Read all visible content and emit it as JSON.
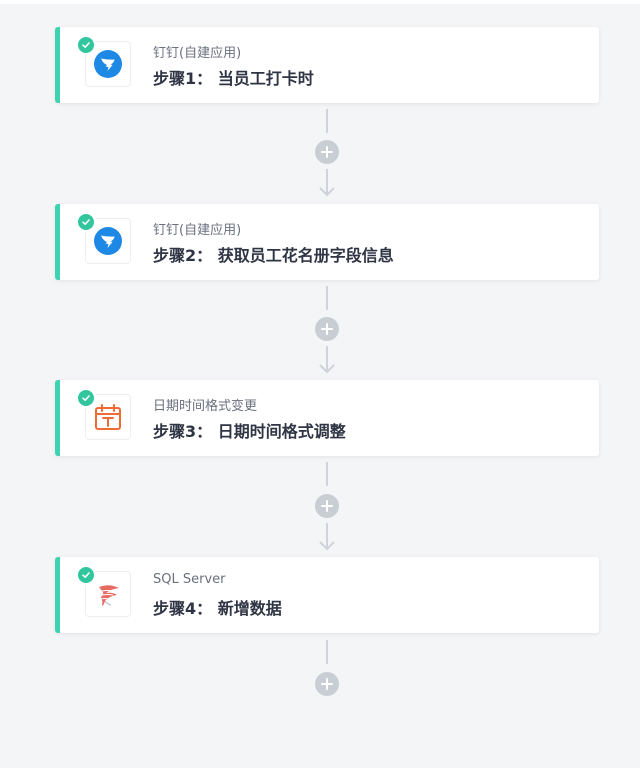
{
  "workflow": {
    "steps": [
      {
        "app_name": "钉钉(自建应用)",
        "title": "步骤1： 当员工打卡时",
        "icon": "dingtalk-icon",
        "status": "success"
      },
      {
        "app_name": "钉钉(自建应用)",
        "title": "步骤2： 获取员工花名册字段信息",
        "icon": "dingtalk-icon",
        "status": "success"
      },
      {
        "app_name": "日期时间格式变更",
        "title": "步骤3： 日期时间格式调整",
        "icon": "calendar-icon",
        "status": "success"
      },
      {
        "app_name": "SQL Server",
        "title": "步骤4： 新增数据",
        "icon": "sql-server-icon",
        "status": "success"
      }
    ]
  },
  "colors": {
    "accent": "#3ed3b0",
    "success": "#32c69e",
    "dingtalk": "#1e88e5",
    "calendar": "#f06a35",
    "sql_server": "#d9403a",
    "connector": "#cfd3da",
    "background": "#f4f5f7"
  }
}
